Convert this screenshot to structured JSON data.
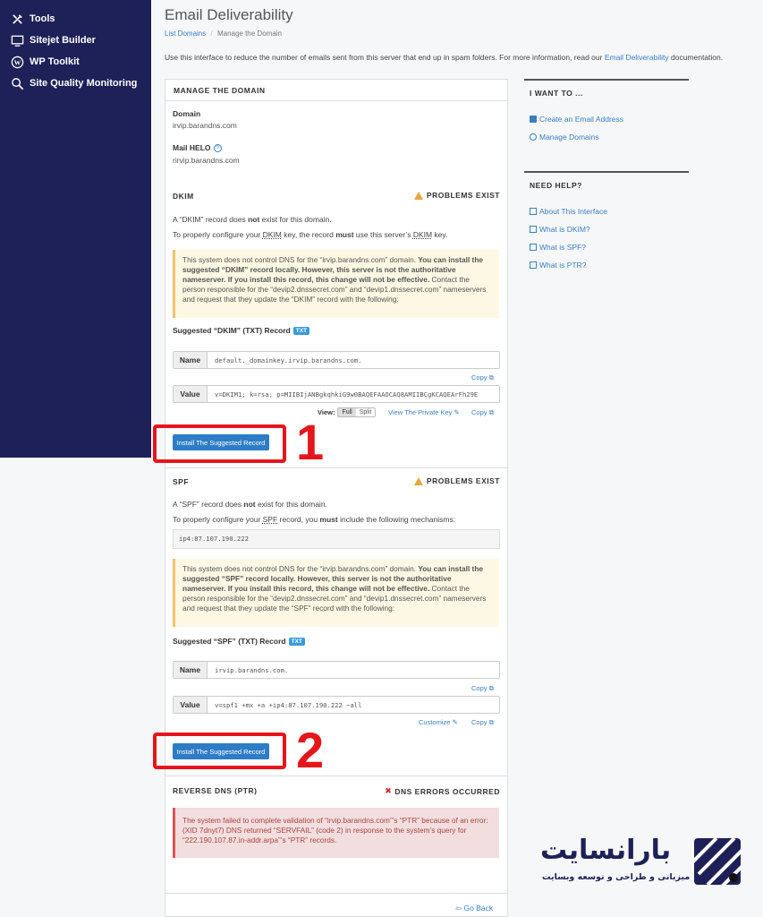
{
  "sidebar": {
    "items": [
      {
        "label": "Tools"
      },
      {
        "label": "Sitejet Builder"
      },
      {
        "label": "WP Toolkit"
      },
      {
        "label": "Site Quality Monitoring"
      }
    ]
  },
  "header": {
    "title": "Email Deliverability",
    "breadcrumb": {
      "parent": "List Domains",
      "sep": "/",
      "current": "Manage the Domain"
    },
    "intro_prefix": "Use this interface to reduce the number of emails sent from this server that end up in spam folders. For more information, read our ",
    "intro_link": "Email Deliverability",
    "intro_suffix": " documentation."
  },
  "panel": {
    "title": "MANAGE THE DOMAIN",
    "domain_label": "Domain",
    "domain_value": "irvip.barandns.com",
    "helo_label": "Mail HELO",
    "helo_value": "rirvip.barandns.com"
  },
  "dkim": {
    "title": "DKIM",
    "status": "PROBLEMS EXIST",
    "line1_a": "A “DKIM” record does ",
    "line1_b": "not",
    "line1_c": " exist for this domain.",
    "line2_a": "To properly configure your ",
    "line2_b": "DKIM",
    "line2_c": " key, the record ",
    "line2_d": "must",
    "line2_e": " use this server’s ",
    "line2_f": "DKIM",
    "line2_g": " key.",
    "note_a": "This system does not control DNS for the “irvip.barandns.com” domain. ",
    "note_b": "You can install the suggested “DKIM” record locally. However, this server is not the authoritative nameserver. If you install this record, this change will not be effective.",
    "note_c": " Contact the person responsible for the “devip2.dnssecret.com” and “devip1.dnssecret.com” nameservers and request that they update the “DKIM” record with the following:",
    "suggested": "Suggested “DKIM” (TXT) Record",
    "tag": "TXT",
    "name_label": "Name",
    "name_value": "default._domainkey.irvip.barandns.com.",
    "value_label": "Value",
    "value_value": "v=DKIM1; k=rsa; p=MIIBIjANBgkqhkiG9w0BAQEFAAOCAQ8AMIIBCgKCAQEArFh29E",
    "copy": "Copy",
    "view_label": "View:",
    "view_full": "Full",
    "view_split": "Split",
    "private_key": "View The Private Key",
    "install": "Install The Suggested Record"
  },
  "spf": {
    "title": "SPF",
    "status": "PROBLEMS EXIST",
    "line1_a": "A “SPF” record does ",
    "line1_b": "not",
    "line1_c": " exist for this domain.",
    "line2_a": "To properly configure your ",
    "line2_b": "SPF",
    "line2_c": " record, you ",
    "line2_d": "must",
    "line2_e": " include the following mechanisms:",
    "mechanism": "ip4:87.107.190.222",
    "note_a": "This system does not control DNS for the “irvip.barandns.com” domain. ",
    "note_b": "You can install the suggested “SPF” record locally. However, this server is not the authoritative nameserver. If you install this record, this change will not be effective.",
    "note_c": " Contact the person responsible for the “devip2.dnssecret.com” and “devip1.dnssecret.com” nameservers and request that they update the “SPF” record with the following:",
    "suggested": "Suggested “SPF” (TXT) Record",
    "tag": "TXT",
    "name_label": "Name",
    "name_value": "irvip.barandns.com.",
    "value_label": "Value",
    "value_value": "v=spf1 +mx +a +ip4:87.107.190.222 ~all",
    "copy": "Copy",
    "customize": "Customize",
    "install": "Install The Suggested Record"
  },
  "ptr": {
    "title": "REVERSE DNS (PTR)",
    "status": "DNS ERRORS OCCURRED",
    "error": "The system failed to complete validation of “irvip.barandns.com”’s “PTR” because of an error: (XID 7dnyt7) DNS returned “SERVFAIL” (code 2) in response to the system’s query for “222.190.107.87.in-addr.arpa”’s “PTR” records."
  },
  "go_back": "Go Back",
  "annotations": {
    "one": "1",
    "two": "2",
    "color": "#e5161b"
  },
  "want_to": {
    "title": "I WANT TO ...",
    "links": [
      {
        "label": "Create an Email Address"
      },
      {
        "label": "Manage Domains"
      }
    ]
  },
  "need_help": {
    "title": "NEED HELP?",
    "links": [
      {
        "label": "About This Interface"
      },
      {
        "label": "What is DKIM?"
      },
      {
        "label": "What is SPF?"
      },
      {
        "label": "What is PTR?"
      }
    ]
  },
  "logo": {
    "name": "بارانسایت",
    "tagline": "میزبانی و طراحی و توسعه وبسایت"
  },
  "colors": {
    "sidebar": "#1e2157",
    "link": "#3b7ec2",
    "button": "#2e7cc6",
    "warning": "#e8a73a",
    "error": "#c9302c"
  }
}
